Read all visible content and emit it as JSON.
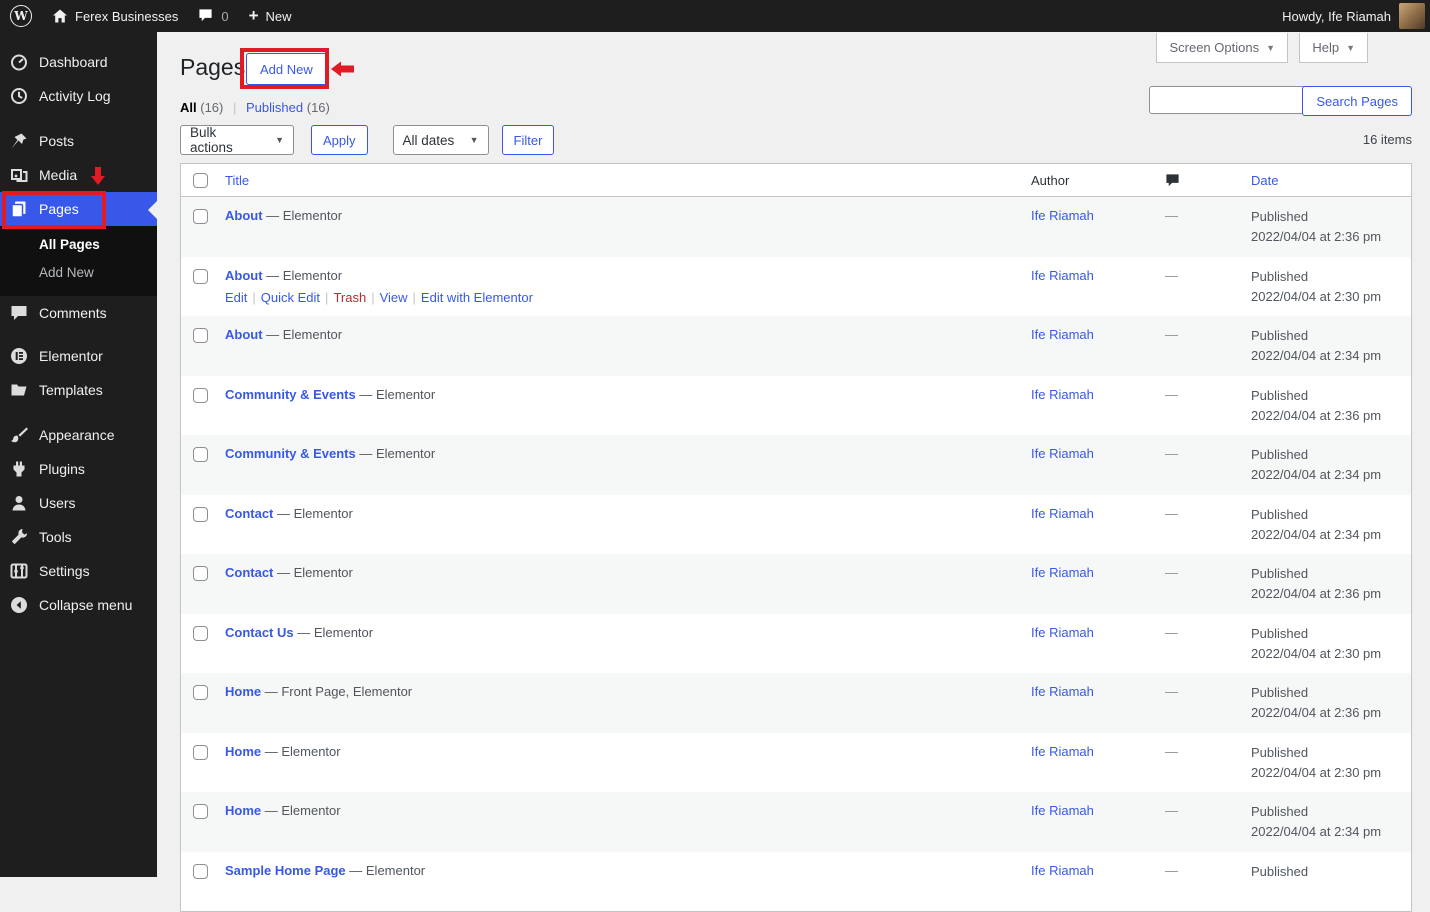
{
  "admin_bar": {
    "site_name": "Ferex Businesses",
    "comment_count": "0",
    "new_label": "New",
    "howdy_text": "Howdy, Ife Riamah"
  },
  "sidebar": {
    "items": [
      {
        "label": "Dashboard"
      },
      {
        "label": "Activity Log"
      },
      {
        "label": "Posts"
      },
      {
        "label": "Media"
      },
      {
        "label": "Pages"
      },
      {
        "label": "Comments"
      },
      {
        "label": "Elementor"
      },
      {
        "label": "Templates"
      },
      {
        "label": "Appearance"
      },
      {
        "label": "Plugins"
      },
      {
        "label": "Users"
      },
      {
        "label": "Tools"
      },
      {
        "label": "Settings"
      },
      {
        "label": "Collapse menu"
      }
    ],
    "pages_submenu": [
      {
        "label": "All Pages"
      },
      {
        "label": "Add New"
      }
    ]
  },
  "page_header": {
    "title": "Pages",
    "add_new_label": "Add New",
    "screen_options_label": "Screen Options",
    "help_label": "Help"
  },
  "views": {
    "all_label": "All",
    "all_count": "(16)",
    "published_label": "Published",
    "published_count": "(16)"
  },
  "toolbar": {
    "bulk_actions_label": "Bulk actions",
    "apply_label": "Apply",
    "all_dates_label": "All dates",
    "filter_label": "Filter",
    "search_button_label": "Search Pages",
    "items_count": "16 items"
  },
  "table": {
    "header": {
      "title": "Title",
      "author": "Author",
      "date": "Date"
    },
    "rows": [
      {
        "title": "About",
        "suffix": " — Elementor",
        "author": "Ife Riamah",
        "comments": "—",
        "status": "Published",
        "date": "2022/04/04 at 2:36 pm"
      },
      {
        "title": "About",
        "suffix": " — Elementor",
        "author": "Ife Riamah",
        "comments": "—",
        "status": "Published",
        "date": "2022/04/04 at 2:30 pm",
        "actions": [
          "Edit",
          "Quick Edit",
          "Trash",
          "View",
          "Edit with Elementor"
        ]
      },
      {
        "title": "About",
        "suffix": " — Elementor",
        "author": "Ife Riamah",
        "comments": "—",
        "status": "Published",
        "date": "2022/04/04 at 2:34 pm"
      },
      {
        "title": "Community & Events",
        "suffix": " — Elementor",
        "author": "Ife Riamah",
        "comments": "—",
        "status": "Published",
        "date": "2022/04/04 at 2:36 pm"
      },
      {
        "title": "Community & Events",
        "suffix": " — Elementor",
        "author": "Ife Riamah",
        "comments": "—",
        "status": "Published",
        "date": "2022/04/04 at 2:34 pm"
      },
      {
        "title": "Contact",
        "suffix": " — Elementor",
        "author": "Ife Riamah",
        "comments": "—",
        "status": "Published",
        "date": "2022/04/04 at 2:34 pm"
      },
      {
        "title": "Contact",
        "suffix": " — Elementor",
        "author": "Ife Riamah",
        "comments": "—",
        "status": "Published",
        "date": "2022/04/04 at 2:36 pm"
      },
      {
        "title": "Contact Us",
        "suffix": " — Elementor",
        "author": "Ife Riamah",
        "comments": "—",
        "status": "Published",
        "date": "2022/04/04 at 2:30 pm"
      },
      {
        "title": "Home",
        "suffix": " — Front Page, Elementor",
        "author": "Ife Riamah",
        "comments": "—",
        "status": "Published",
        "date": "2022/04/04 at 2:36 pm"
      },
      {
        "title": "Home",
        "suffix": " — Elementor",
        "author": "Ife Riamah",
        "comments": "—",
        "status": "Published",
        "date": "2022/04/04 at 2:30 pm"
      },
      {
        "title": "Home",
        "suffix": " — Elementor",
        "author": "Ife Riamah",
        "comments": "—",
        "status": "Published",
        "date": "2022/04/04 at 2:34 pm"
      },
      {
        "title": "Sample Home Page",
        "suffix": " — Elementor",
        "author": "Ife Riamah",
        "comments": "—",
        "status": "Published",
        "date": ""
      }
    ]
  },
  "colors": {
    "accent": "#3858e9",
    "annotation_red": "#e01b24",
    "sidebar_bg": "#1e1e1e",
    "content_bg": "#f0f0f1",
    "stripe": "#f6f7f7",
    "trash_red": "#b32d2e"
  }
}
